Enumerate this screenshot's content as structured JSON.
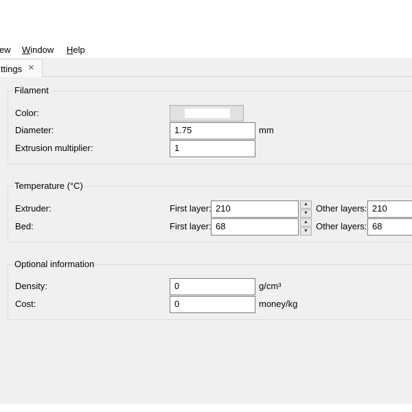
{
  "menubar": {
    "items": [
      {
        "pre": "",
        "u": "",
        "post": "ew"
      },
      {
        "pre": "",
        "u": "W",
        "post": "indow"
      },
      {
        "pre": "",
        "u": "H",
        "post": "elp"
      }
    ]
  },
  "tabs": [
    {
      "label": "ttings",
      "close_icon": "×"
    }
  ],
  "filament": {
    "title": "Filament",
    "color_label": "Color:",
    "color_value": "#ffffff",
    "diameter_label": "Diameter:",
    "diameter_value": "1.75",
    "diameter_unit": "mm",
    "extrusion_label": "Extrusion multiplier:",
    "extrusion_value": "1"
  },
  "temperature": {
    "title": "Temperature (°C)",
    "extruder_label": "Extruder:",
    "bed_label": "Bed:",
    "first_layer_label": "First layer:",
    "other_layers_label": "Other layers:",
    "extruder_first": "210",
    "extruder_other": "210",
    "bed_first": "68",
    "bed_other": "68",
    "spin_up": "▲",
    "spin_down": "▼"
  },
  "optional": {
    "title": "Optional information",
    "density_label": "Density:",
    "density_value": "0",
    "density_unit": "g/cm³",
    "cost_label": "Cost:",
    "cost_value": "0",
    "cost_unit": "money/kg"
  }
}
